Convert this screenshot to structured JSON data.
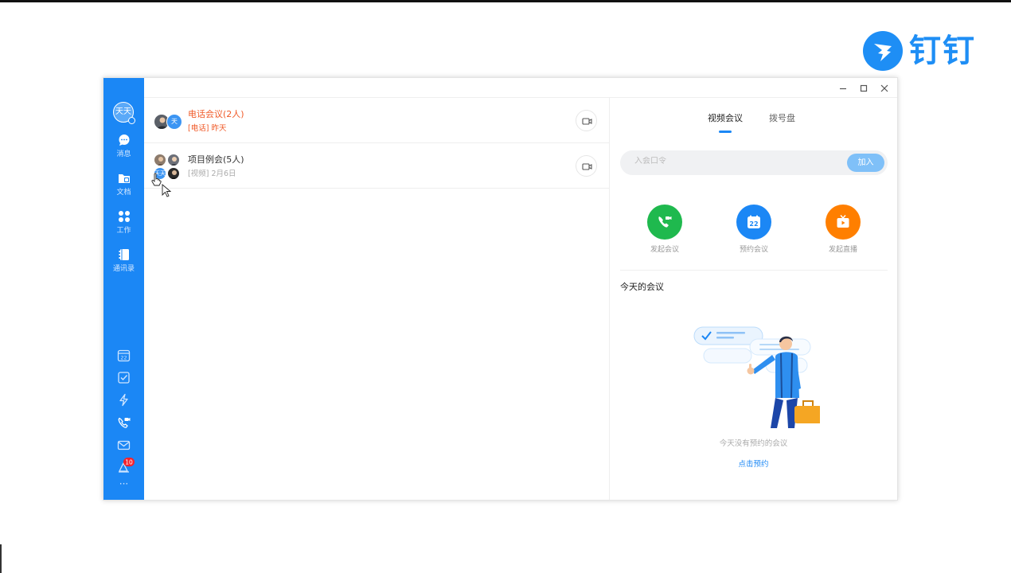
{
  "brand": {
    "name": "钉钉",
    "color": "#1e8ef5"
  },
  "sidebar": {
    "accent": "#1b87f5",
    "avatar": "天天",
    "items": [
      {
        "label": "消息",
        "icon": "chat-icon"
      },
      {
        "label": "文档",
        "icon": "folder-icon"
      },
      {
        "label": "工作",
        "icon": "apps-icon"
      },
      {
        "label": "通讯录",
        "icon": "contacts-icon"
      }
    ],
    "tools": [
      "calendar-icon",
      "todo-icon",
      "flash-icon",
      "phone-video-icon",
      "mail-icon",
      "ding-icon",
      "more-icon"
    ],
    "calendar_day": "22",
    "ding_badge": "10",
    "more": "···"
  },
  "meetings": [
    {
      "title": "电话会议(2人)",
      "tag": "[电话]",
      "time": "昨天",
      "color": "#f05a28",
      "member_label": "天"
    },
    {
      "title": "项目例会(5人)",
      "tag": "[视频]",
      "time": "2月6日",
      "color": "#333333",
      "member_label": "天天"
    }
  ],
  "right": {
    "tabs": [
      {
        "label": "视频会议",
        "active": true
      },
      {
        "label": "拨号盘",
        "active": false
      }
    ],
    "search_placeholder": "入会口令",
    "join_label": "加入",
    "actions": [
      {
        "label": "发起会议",
        "color": "#1fb94e",
        "icon": "phone-video-icon"
      },
      {
        "label": "预约会议",
        "color": "#1b87f5",
        "icon": "calendar-icon",
        "day": "22"
      },
      {
        "label": "发起直播",
        "color": "#ff7f00",
        "icon": "live-icon"
      }
    ],
    "today_title": "今天的会议",
    "empty_text": "今天没有预约的会议",
    "book_link": "点击预约"
  }
}
